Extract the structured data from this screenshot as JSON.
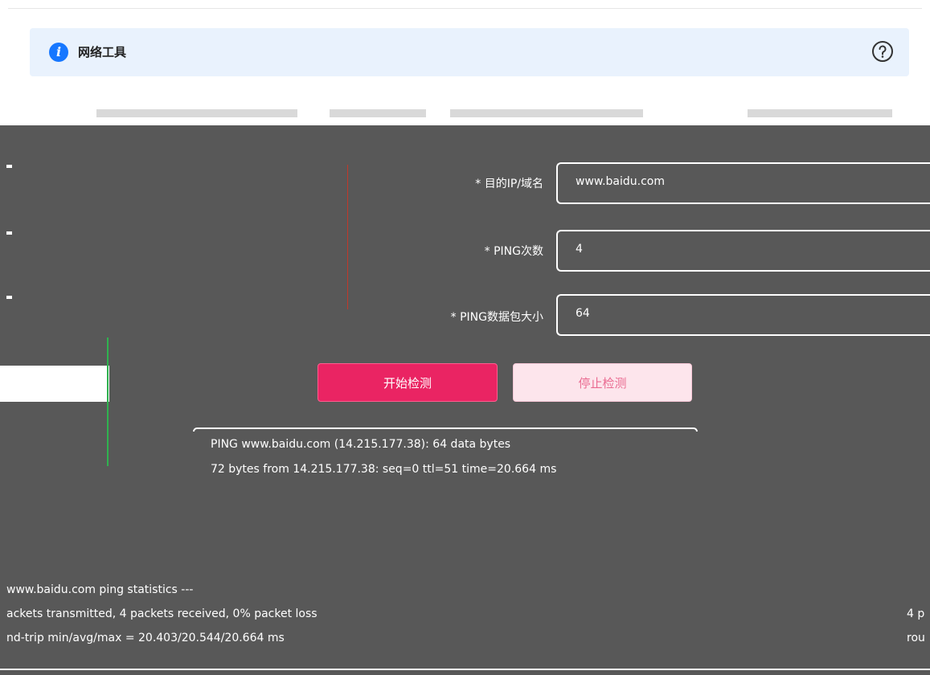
{
  "header": {
    "title": "网络工具",
    "info_icon": "info-icon",
    "help_icon": "help-icon"
  },
  "form": {
    "target_label": "* 目的IP/域名",
    "target_value": "www.baidu.com",
    "count_label": "* PING次数",
    "count_value": "4",
    "size_label": "* PING数据包大小",
    "size_value": "64"
  },
  "buttons": {
    "start_label": "开始检测",
    "stop_label": "停止检测"
  },
  "output": {
    "lines": [
      "PING www.baidu.com (14.215.177.38): 64 data bytes",
      "72 bytes from 14.215.177.38: seq=0 ttl=51 time=20.664 ms"
    ],
    "stats": [
      "www.baidu.com ping statistics ---",
      "ackets transmitted, 4 packets received, 0% packet loss",
      "nd-trip min/avg/max = 20.403/20.544/20.664 ms"
    ],
    "right_fragments": [
      "4 p",
      "rou"
    ]
  },
  "colors": {
    "accent": "#ea2463",
    "info": "#1677ff",
    "banner_bg": "#e9f2fd"
  }
}
